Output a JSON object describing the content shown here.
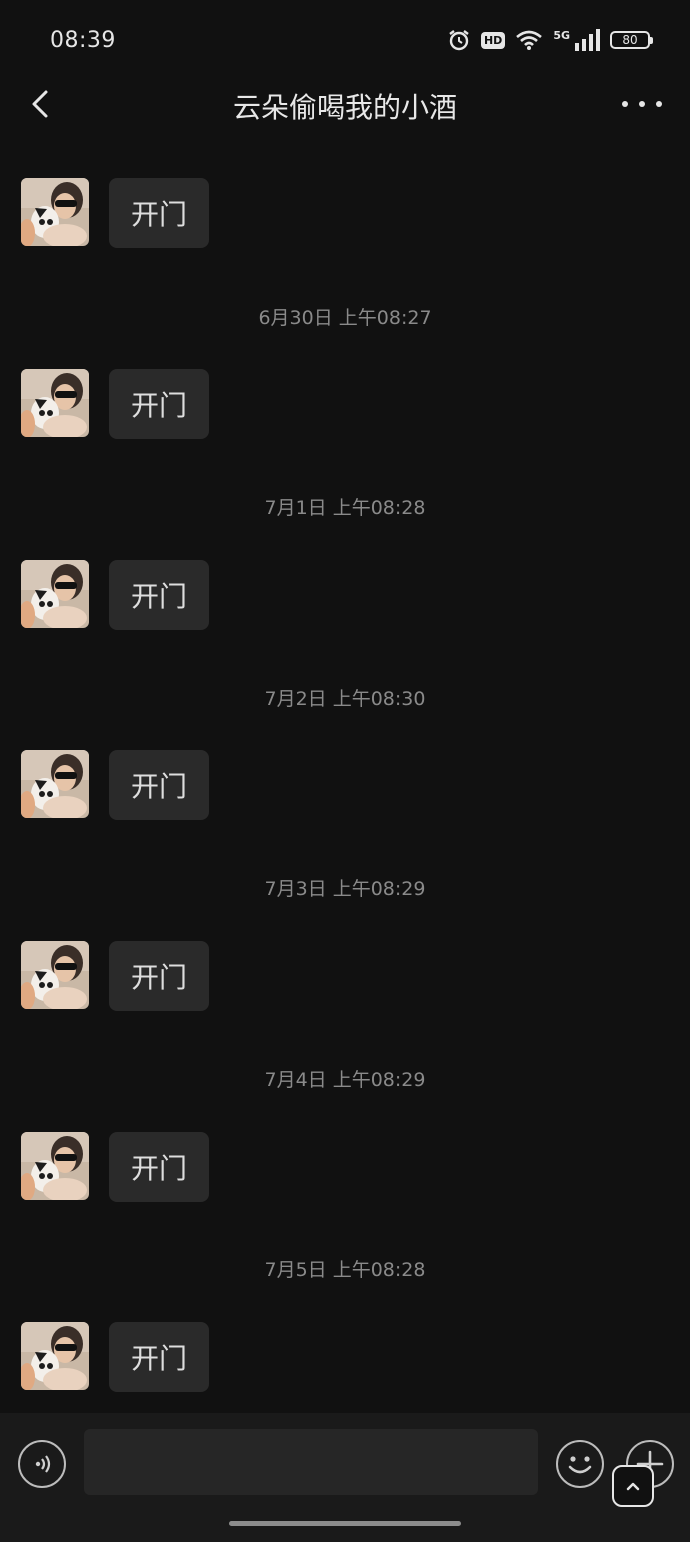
{
  "status_bar": {
    "time": "08:39",
    "hd_label": "HD",
    "network_label": "5G",
    "battery_level": "80"
  },
  "header": {
    "title": "云朵偷喝我的小酒"
  },
  "messages": [
    {
      "text": "开门",
      "timestamp": ""
    },
    {
      "text": "开门",
      "timestamp": "6月30日 上午08:27"
    },
    {
      "text": "开门",
      "timestamp": "7月1日 上午08:28"
    },
    {
      "text": "开门",
      "timestamp": "7月2日 上午08:30"
    },
    {
      "text": "开门",
      "timestamp": "7月3日 上午08:29"
    },
    {
      "text": "开门",
      "timestamp": "7月4日 上午08:29"
    },
    {
      "text": "开门",
      "timestamp": "7月5日 上午08:28"
    }
  ],
  "input_bar": {
    "placeholder": ""
  },
  "icons": {
    "back": "chevron-left-icon",
    "more": "more-dots-icon",
    "voice": "voice-icon",
    "emoji": "smiley-icon",
    "plus": "plus-icon",
    "scroll_top": "chevron-up-icon"
  }
}
